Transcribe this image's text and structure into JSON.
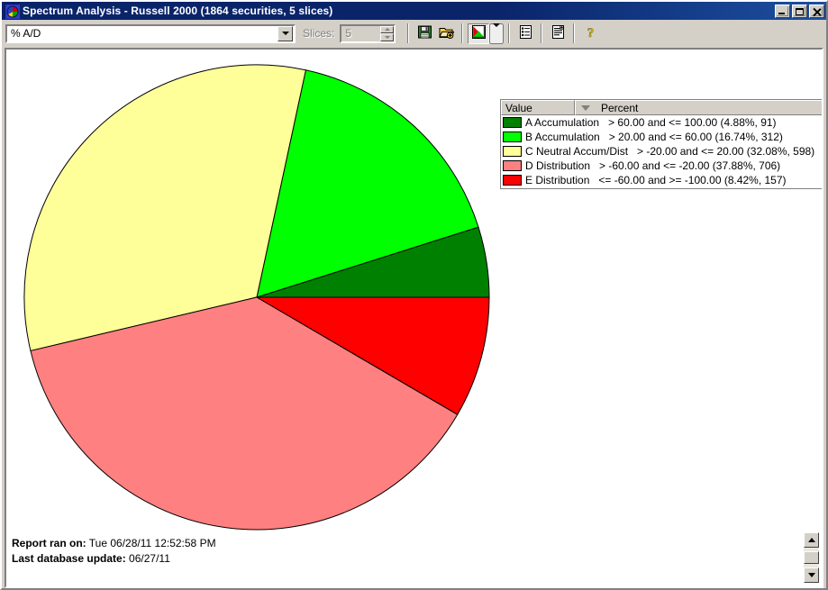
{
  "window": {
    "title": "Spectrum Analysis - Russell 2000 (1864 securities, 5 slices)",
    "icon": "pie-chart-icon",
    "minimize_label": "Minimize",
    "maximize_label": "Maximize",
    "close_label": "Close"
  },
  "toolbar": {
    "metric_select_value": "% A/D",
    "metric_select_placeholder": "% A/D",
    "slices_label": "Slices:",
    "slices_value": "5",
    "buttons": [
      {
        "name": "save-button",
        "icon": "floppy-disk-icon",
        "label": "Save"
      },
      {
        "name": "open-button",
        "icon": "open-folder-icon",
        "label": "Open"
      },
      {
        "name": "pie-view-button",
        "icon": "pie-chart-icon",
        "label": "Pie Chart View"
      },
      {
        "name": "pie-view-dropdown",
        "icon": "chevron-down-icon",
        "label": "Chart Options"
      },
      {
        "name": "list-view-button",
        "icon": "list-report-icon",
        "label": "List View"
      },
      {
        "name": "detail-report-button",
        "icon": "detail-report-icon",
        "label": "Detail Report"
      },
      {
        "name": "help-button",
        "icon": "question-mark-icon",
        "label": "Help"
      }
    ]
  },
  "legend": {
    "columns": [
      "Value",
      "Percent"
    ],
    "sort_indicator": "descending",
    "rows": [
      {
        "color": "#008000",
        "name": "A Accumulation",
        "range": "> 60.00 and <= 100.00 (4.88%, 91)"
      },
      {
        "color": "#00ff00",
        "name": "B Accumulation",
        "range": "> 20.00 and <= 60.00 (16.74%, 312)"
      },
      {
        "color": "#ffff99",
        "name": "C Neutral Accum/Dist",
        "range": "> -20.00 and <= 20.00 (32.08%, 598)"
      },
      {
        "color": "#ff8080",
        "name": "D Distribution",
        "range": "> -60.00 and <= -20.00 (37.88%, 706)"
      },
      {
        "color": "#ff0000",
        "name": "E Distribution",
        "range": "<= -60.00 and >= -100.00 (8.42%, 157)"
      }
    ]
  },
  "footer": {
    "report_ran_label": "Report ran on:",
    "report_ran_value": "Tue 06/28/11 12:52:58 PM",
    "last_update_label": "Last database update:",
    "last_update_value": "06/27/11"
  },
  "chart_data": {
    "type": "pie",
    "title": "Spectrum Analysis - Russell 2000",
    "total_securities": 1864,
    "slice_count": 5,
    "direction": "counterclockwise",
    "start_angle_deg": 0,
    "center": [
      280,
      328
    ],
    "radius": 258,
    "categories": [
      "A Accumulation",
      "B Accumulation",
      "C Neutral Accum/Dist",
      "D Distribution",
      "E Distribution"
    ],
    "values": [
      4.88,
      16.74,
      32.08,
      37.88,
      8.42
    ],
    "counts": [
      91,
      312,
      598,
      706,
      157
    ],
    "colors": [
      "#008000",
      "#00ff00",
      "#ffff99",
      "#ff8080",
      "#ff0000"
    ],
    "ranges": [
      "> 60.00 and <= 100.00",
      "> 20.00 and <= 60.00",
      "> -20.00 and <= 20.00",
      "> -60.00 and <= -20.00",
      "<= -60.00 and >= -100.00"
    ],
    "ylabel": "Percent",
    "xlabel": "Value",
    "legend_position": "top-right"
  }
}
